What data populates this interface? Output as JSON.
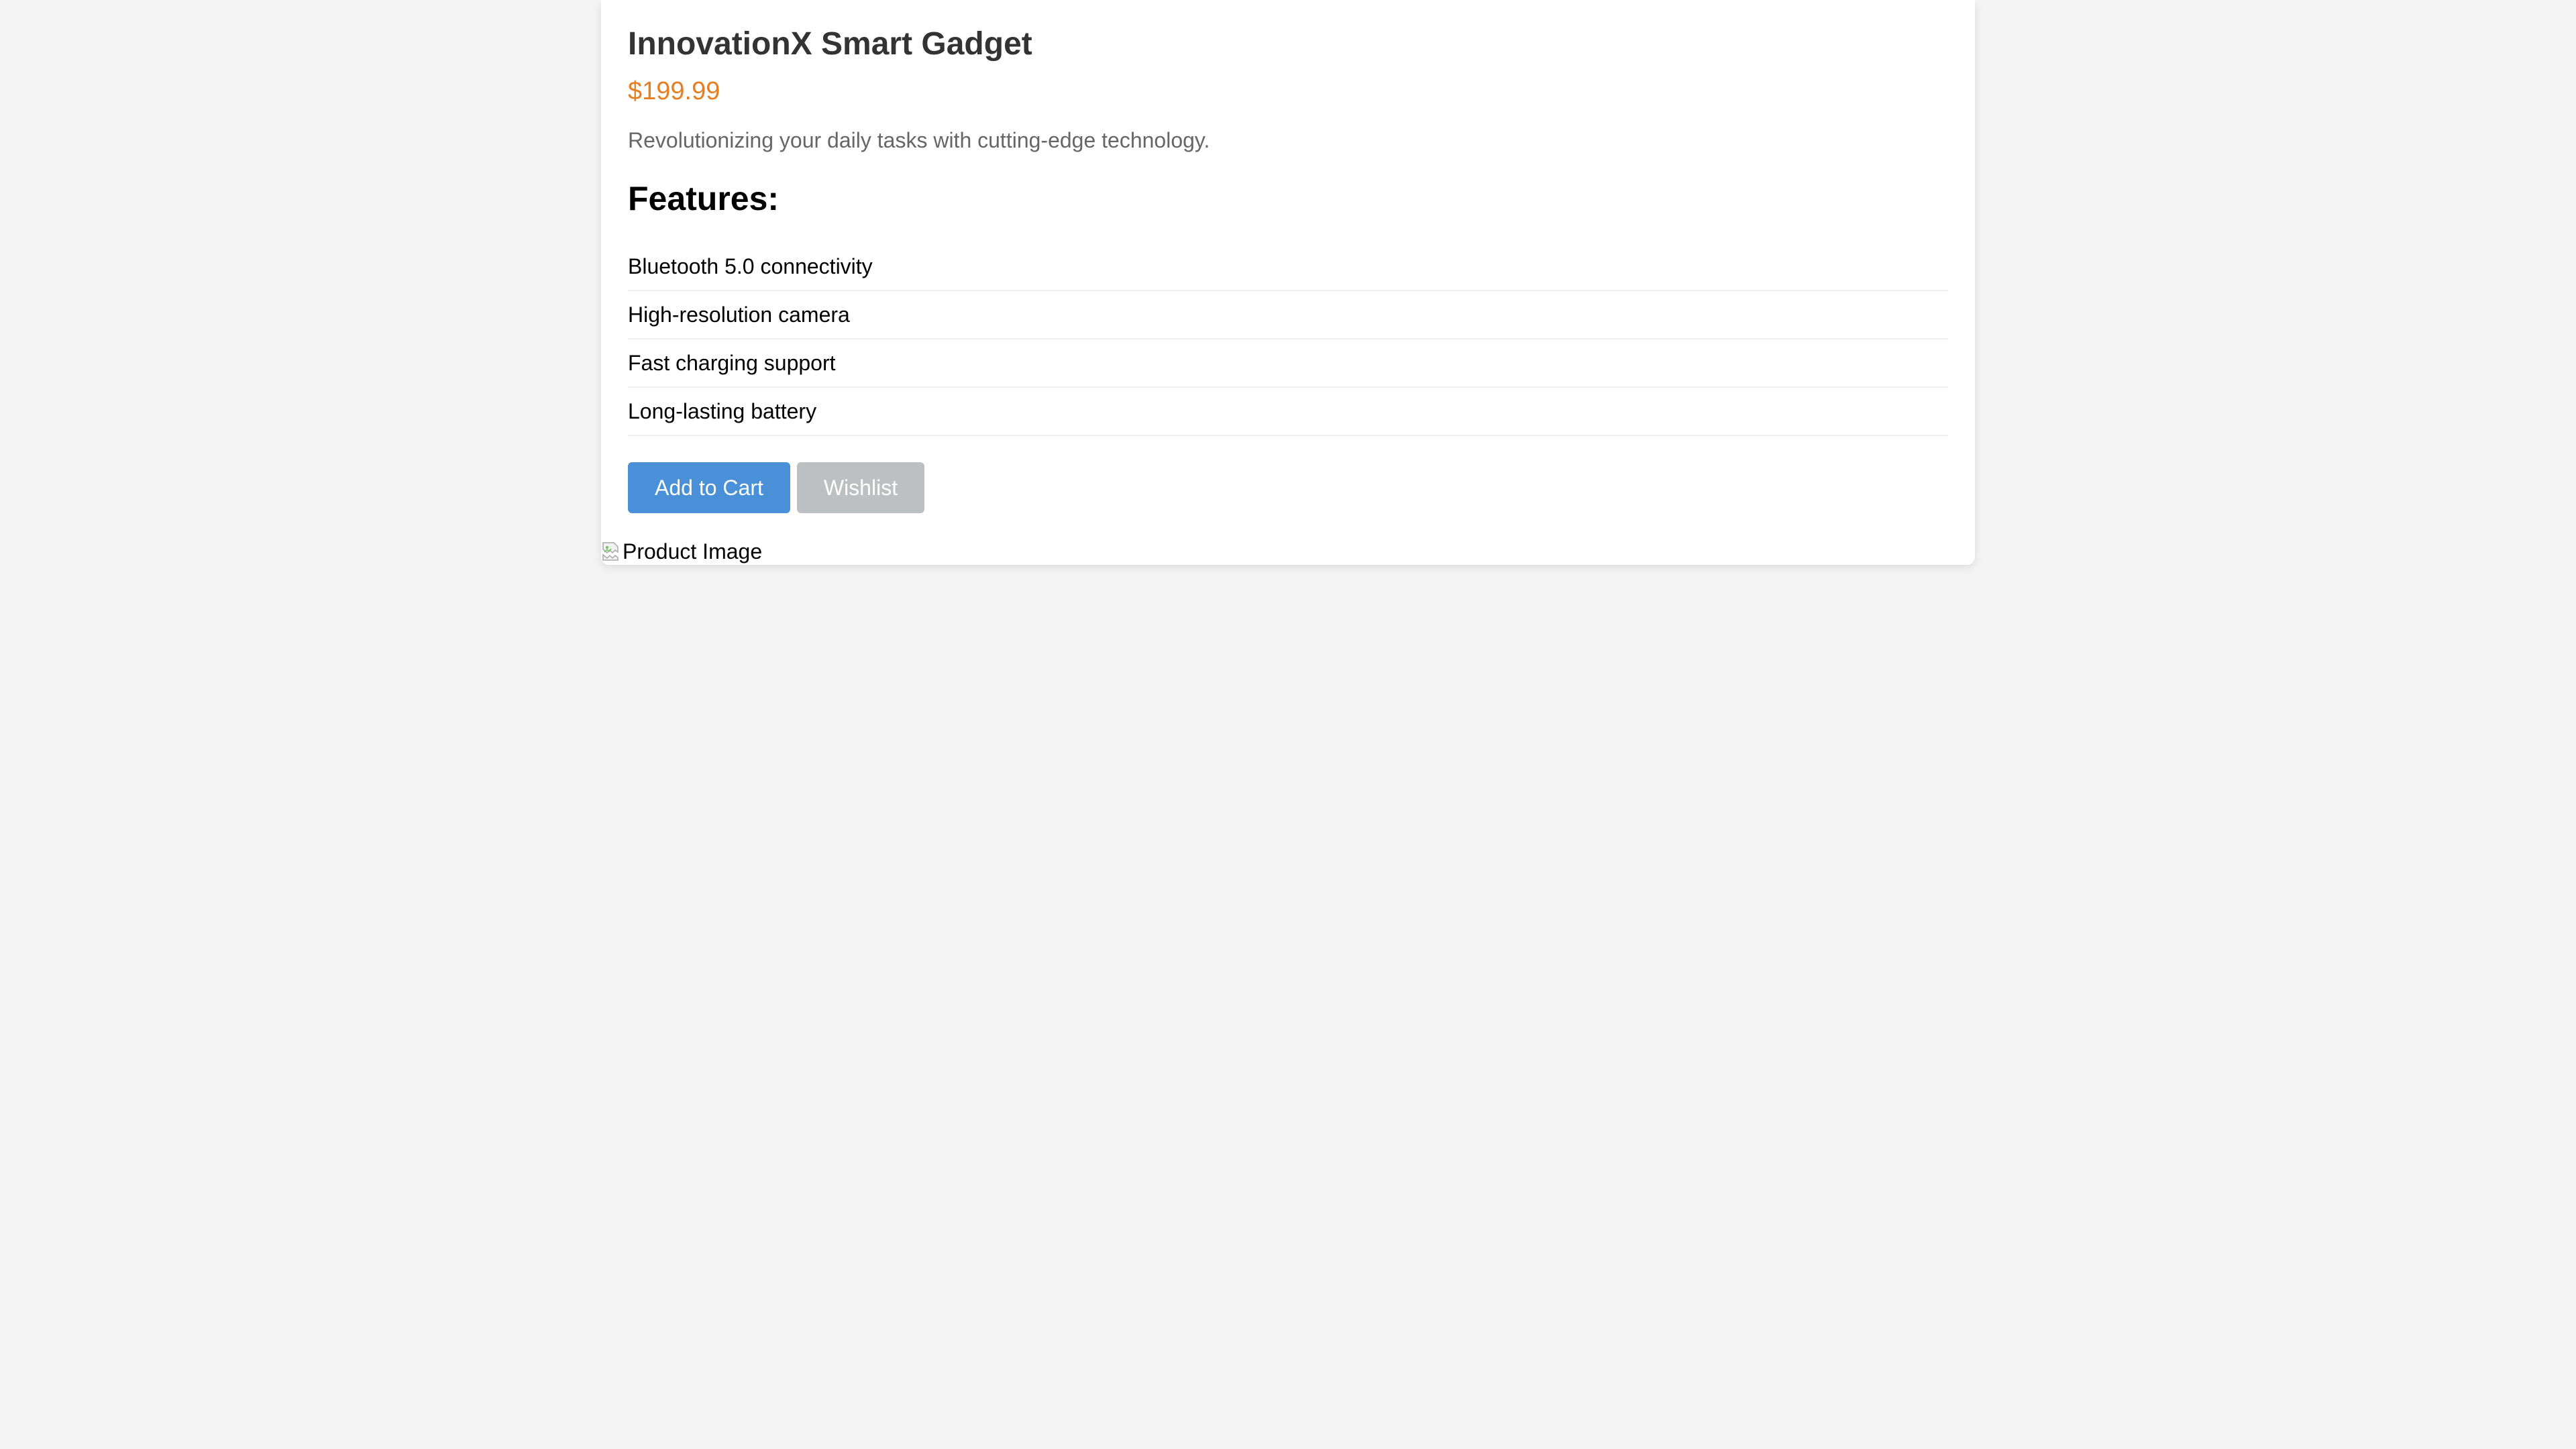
{
  "product": {
    "title": "InnovationX Smart Gadget",
    "price": "$199.99",
    "description": "Revolutionizing your daily tasks with cutting-edge technology."
  },
  "features": {
    "heading": "Features:",
    "items": [
      "Bluetooth 5.0 connectivity",
      "High-resolution camera",
      "Fast charging support",
      "Long-lasting battery"
    ]
  },
  "actions": {
    "add_to_cart_label": "Add to Cart",
    "wishlist_label": "Wishlist"
  },
  "image": {
    "alt": "Product Image",
    "icon": "broken-image-icon"
  },
  "colors": {
    "page_background": "#f4f4f4",
    "card_background": "#ffffff",
    "price": "#e67e22",
    "primary_button": "#4a90d9",
    "secondary_button": "#bdc0c3"
  }
}
